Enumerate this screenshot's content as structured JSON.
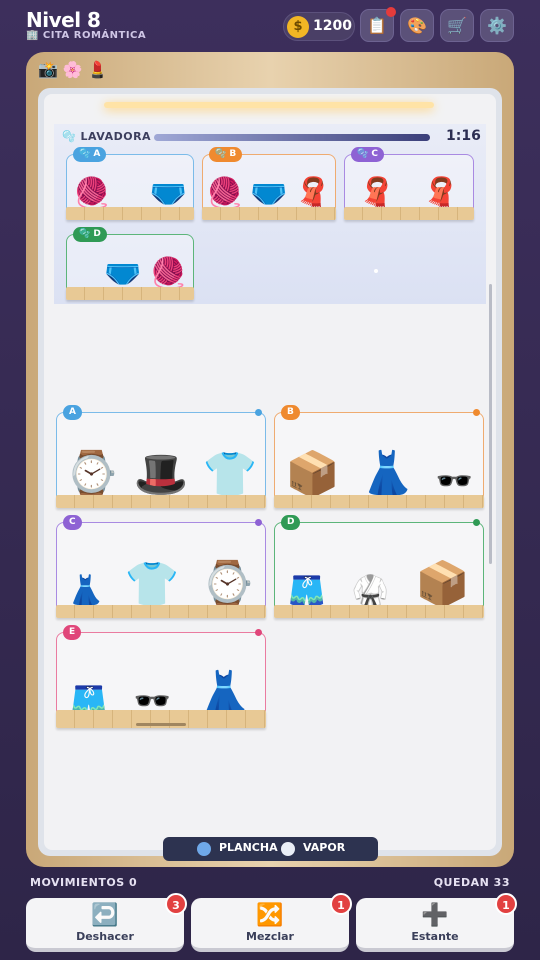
{
  "header": {
    "level_title": "Nivel 8",
    "subtitle": "🏢 CITA ROMÁNTICA",
    "coin_icon": "$",
    "coins": "1200",
    "buttons": [
      {
        "name": "clipboard-button",
        "icon": "📋"
      },
      {
        "name": "palette-button",
        "icon": "🎨"
      },
      {
        "name": "shop-button",
        "icon": "🛒"
      },
      {
        "name": "settings-button",
        "icon": "⚙️"
      }
    ]
  },
  "decorations": [
    "📸",
    "🌸",
    "💄"
  ],
  "washer": {
    "label": "LAVADORA",
    "timer": "1:16",
    "progress": 0.95,
    "slots": [
      {
        "tag": "A",
        "items": [
          "🧶",
          "🩲"
        ]
      },
      {
        "tag": "B",
        "items": [
          "🧶",
          "🩲",
          "🧣"
        ]
      },
      {
        "tag": "C",
        "items": [
          "🧣",
          "🧣"
        ]
      },
      {
        "tag": "D",
        "items": [
          "🩲",
          "🧶"
        ]
      }
    ]
  },
  "shelves": [
    {
      "tag": "A",
      "color": "#4aa3e0",
      "items": [
        "⌚",
        "🎩",
        "👕"
      ]
    },
    {
      "tag": "B",
      "color": "#ef8a2f",
      "items": [
        "📦",
        "👗",
        "🕶️"
      ]
    },
    {
      "tag": "C",
      "color": "#8e62d4",
      "items": [
        "👗",
        "👕",
        "⌚"
      ]
    },
    {
      "tag": "D",
      "color": "#2f9a55",
      "items": [
        "🩳",
        "🥋",
        "📦"
      ]
    },
    {
      "tag": "E",
      "color": "#e0467a",
      "items": [
        "🩳",
        "🕶️",
        "👗"
      ]
    }
  ],
  "mode": {
    "left": "PLANCHA",
    "right": "VAPOR"
  },
  "footer": {
    "moves": "MOVIMIENTOS 0",
    "remaining": "QUEDAN 33",
    "buttons": [
      {
        "label": "Deshacer",
        "icon": "↩️",
        "badge": "3"
      },
      {
        "label": "Mezclar",
        "icon": "🔀",
        "badge": "1"
      },
      {
        "label": "Estante",
        "icon": "➕",
        "badge": "1"
      }
    ]
  }
}
